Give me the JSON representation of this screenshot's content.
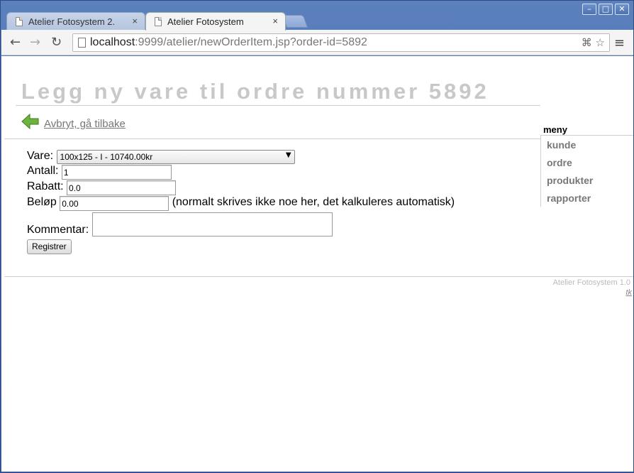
{
  "window": {
    "controls": [
      "–",
      "□",
      "✕"
    ]
  },
  "tabs": [
    {
      "label": "Atelier Fotosystem 2.",
      "close": "×"
    },
    {
      "label": "Atelier Fotosystem",
      "close": "×"
    }
  ],
  "toolbar": {
    "back": "←",
    "forward": "→",
    "reload": "↻",
    "url_host": "localhost",
    "url_rest": ":9999/atelier/newOrderItem.jsp?order-id=5892",
    "menu": "≡",
    "star": "☆",
    "translate": "⌘"
  },
  "page": {
    "title": "Legg ny vare til ordre nummer 5892",
    "back_link": "Avbryt, gå tilbake"
  },
  "menu": {
    "title": "meny",
    "items": [
      "kunde",
      "ordre",
      "produkter",
      "rapporter"
    ]
  },
  "form": {
    "vare_label": "Vare:",
    "vare_value": "100x125 - I - 10740.00kr",
    "antall_label": "Antall:",
    "antall_value": "1",
    "rabatt_label": "Rabatt:",
    "rabatt_value": "0.0",
    "belop_label": "Beløp",
    "belop_value": "0.00",
    "belop_note": "(normalt skrives ikke noe her, det kalkuleres automatisk)",
    "kommentar_label": "Kommentar:",
    "submit_label": "Registrer"
  },
  "footer": {
    "text": "Atelier Fotosystem 1.0",
    "link": "tk"
  }
}
